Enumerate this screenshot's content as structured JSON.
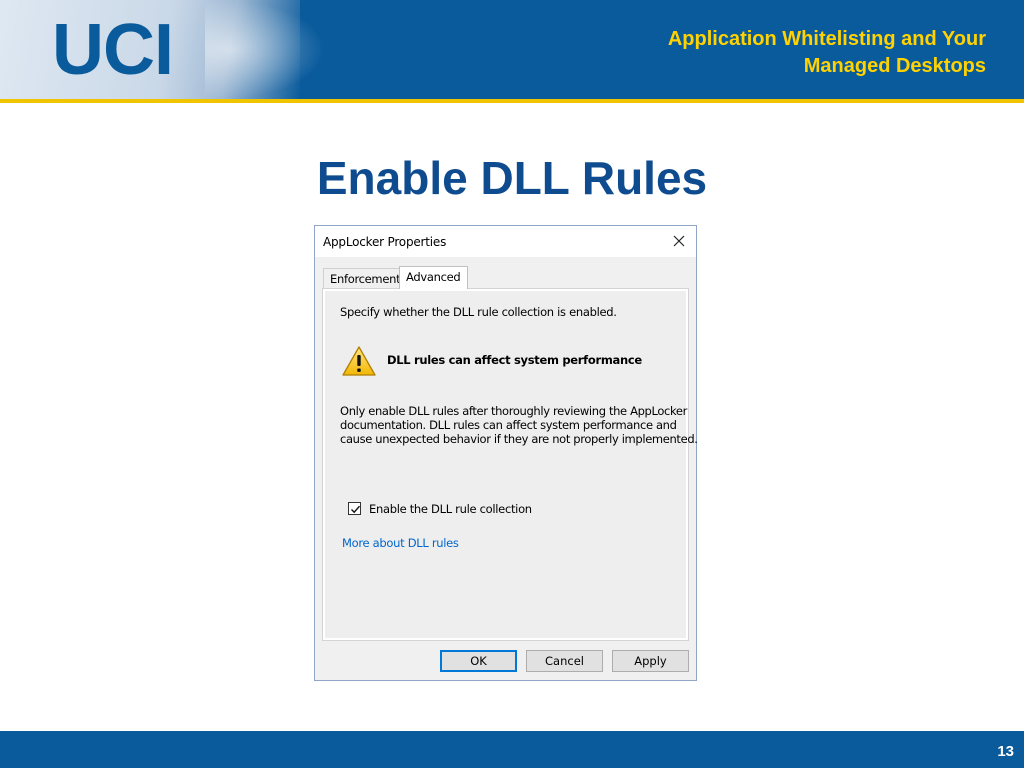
{
  "header": {
    "logo_text": "UCI",
    "title_line1": "Application Whitelisting and Your",
    "title_line2": "Managed Desktops"
  },
  "slide": {
    "title": "Enable DLL Rules",
    "page_number": "13"
  },
  "dialog": {
    "title": "AppLocker Properties",
    "close_icon": "close-icon",
    "tabs": [
      {
        "label": "Enforcement",
        "selected": false
      },
      {
        "label": "Advanced",
        "selected": true
      }
    ],
    "intro_text": "Specify whether the DLL rule collection is enabled.",
    "warning": {
      "icon": "warning-icon",
      "heading": "DLL rules can affect system performance",
      "body_lines": [
        "Only enable DLL rules after thoroughly reviewing the AppLocker",
        "documentation. DLL rules can affect system performance and",
        "cause unexpected behavior if they are not properly implemented."
      ]
    },
    "checkbox": {
      "label": "Enable the DLL rule collection",
      "checked": true
    },
    "link_text": "More about DLL rules",
    "buttons": {
      "ok": "OK",
      "cancel": "Cancel",
      "apply": "Apply"
    }
  },
  "colors": {
    "brand_blue": "#0a5b9c",
    "brand_gold": "#f1c400",
    "title_blue": "#0f4c8f",
    "link_blue": "#0066cc"
  }
}
